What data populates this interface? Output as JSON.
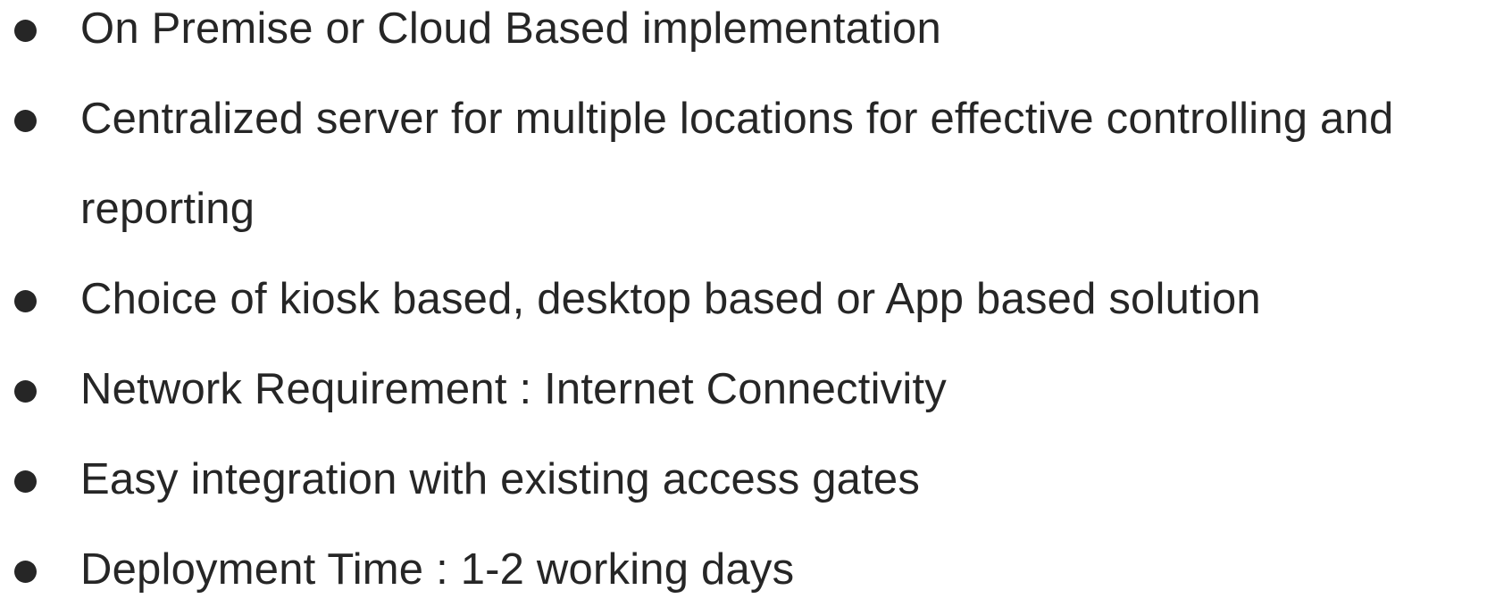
{
  "list": {
    "items": [
      {
        "text": "On Premise or Cloud Based implementation"
      },
      {
        "text": "Centralized server for multiple locations for effective controlling and reporting"
      },
      {
        "text": "Choice of kiosk based, desktop based or App based solution"
      },
      {
        "text": "Network Requirement : Internet Connectivity"
      },
      {
        "text": "Easy integration with existing access gates"
      },
      {
        "text": "Deployment Time : 1-2 working days"
      }
    ]
  }
}
